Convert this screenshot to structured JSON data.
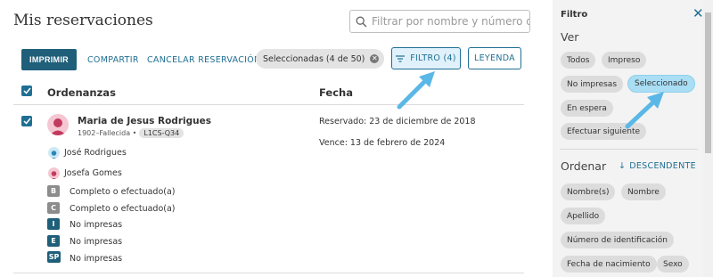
{
  "header": {
    "title": "Mis reservaciones",
    "search_placeholder": "Filtrar por nombre y número de ide"
  },
  "toolbar": {
    "print_label": "IMPRIMIR",
    "share_label": "COMPARTIR",
    "cancel_label": "CANCELAR RESERVACIÓN",
    "selected_chip": "Seleccionadas (4 de 50)",
    "filter_label": "FILTRO (4)",
    "legend_label": "LEYENDA"
  },
  "table": {
    "col_ordinances": "Ordenanzas",
    "col_date": "Fecha",
    "rows": [
      {
        "name": "Maria de Jesus Rodrigues",
        "meta": "1902–Fallecida •",
        "pid": "L1CS-Q34",
        "reserved": "Reservado:  23 de diciembre de 2018",
        "expires": "Vence:  13 de febrero de 2024",
        "relatives": [
          "José Rodrigues",
          "Josefa Gomes"
        ],
        "ordinances": [
          {
            "code": "B",
            "text": "Completo o efectuado(a)"
          },
          {
            "code": "C",
            "text": "Completo o efectuado(a)"
          },
          {
            "code": "I",
            "text": "No impresas"
          },
          {
            "code": "E",
            "text": "No impresas"
          },
          {
            "code": "SP",
            "text": "No impresas"
          }
        ]
      }
    ]
  },
  "filter_panel": {
    "title": "Filtro",
    "view_label": "Ver",
    "view_options": [
      "Todos",
      "Impreso",
      "No impresas",
      "Seleccionado",
      "En espera",
      "Efectuar siguiente"
    ],
    "view_selected": "Seleccionado",
    "sort_label": "Ordenar",
    "sort_direction": "DESCENDENTE",
    "sort_options": [
      "Nombre(s)",
      "Nombre",
      "Apellido",
      "Número de identificación",
      "Fecha de nacimiento",
      "Sexo"
    ]
  },
  "colors": {
    "primary": "#1f5f7a",
    "link": "#1f6f93",
    "active_pill": "#a9def4",
    "arrow": "#5bb8e6",
    "completed_badge": "#8c8c8c",
    "pending_badge": "#1f5f7a"
  }
}
